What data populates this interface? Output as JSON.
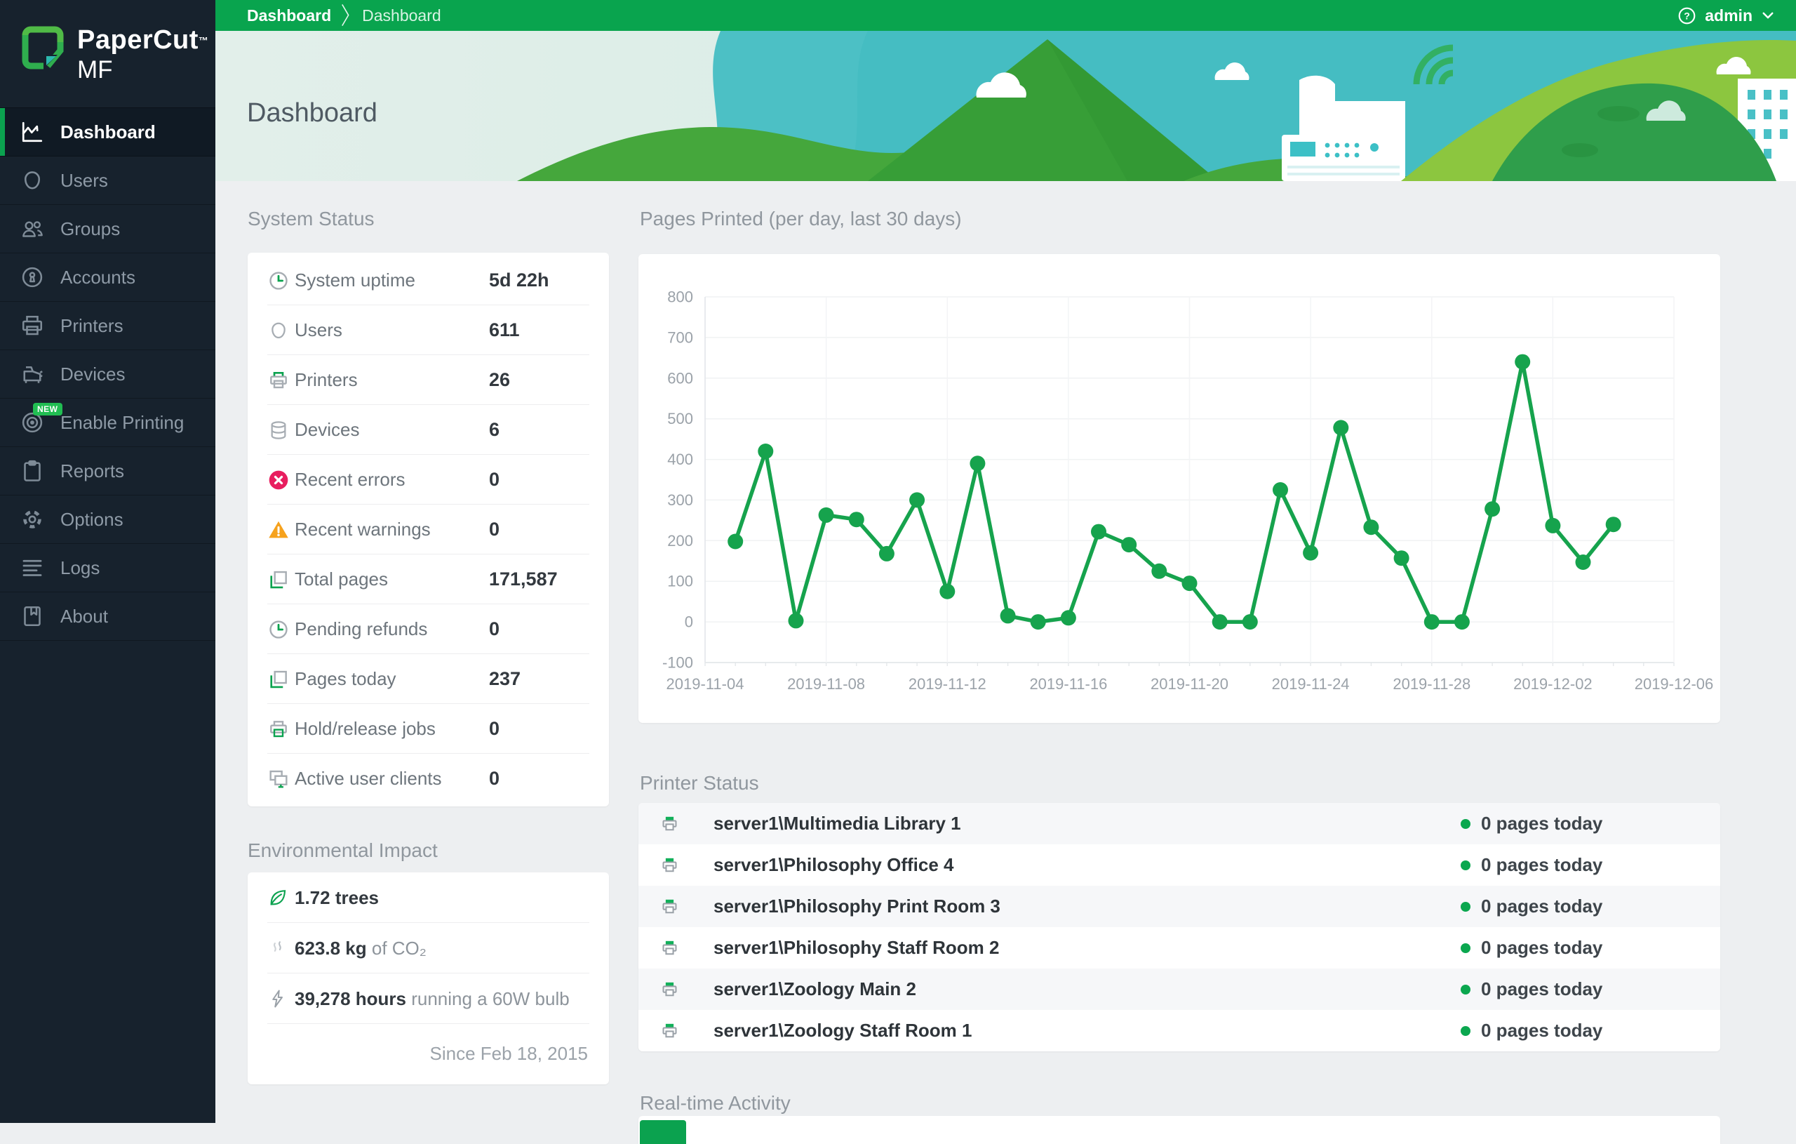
{
  "brand": {
    "name": "PaperCut",
    "tm": "™",
    "product": "MF"
  },
  "topbar": {
    "breadcrumbs": [
      "Dashboard",
      "Dashboard"
    ],
    "user": "admin",
    "accent_color": "#09a44e"
  },
  "header": {
    "title": "Dashboard"
  },
  "sidebar": {
    "items": [
      {
        "label": "Dashboard",
        "icon": "dashboard-icon",
        "active": true
      },
      {
        "label": "Users",
        "icon": "users-icon",
        "active": false
      },
      {
        "label": "Groups",
        "icon": "groups-icon",
        "active": false
      },
      {
        "label": "Accounts",
        "icon": "accounts-icon",
        "active": false
      },
      {
        "label": "Printers",
        "icon": "printers-icon",
        "active": false
      },
      {
        "label": "Devices",
        "icon": "devices-icon",
        "active": false
      },
      {
        "label": "Enable Printing",
        "icon": "enable-printing-target-icon",
        "active": false,
        "badge": "NEW"
      },
      {
        "label": "Reports",
        "icon": "reports-icon",
        "active": false
      },
      {
        "label": "Options",
        "icon": "options-gear-icon",
        "active": false
      },
      {
        "label": "Logs",
        "icon": "logs-icon",
        "active": false
      },
      {
        "label": "About",
        "icon": "about-icon",
        "active": false
      }
    ]
  },
  "system_status": {
    "title": "System Status",
    "rows": [
      {
        "icon": "uptime-clock-icon",
        "label": "System uptime",
        "value": "5d 22h"
      },
      {
        "icon": "user-face-icon",
        "label": "Users",
        "value": "611"
      },
      {
        "icon": "printer-green-icon",
        "label": "Printers",
        "value": "26"
      },
      {
        "icon": "devices-stack-icon",
        "label": "Devices",
        "value": "6"
      },
      {
        "icon": "error-circle-icon",
        "label": "Recent errors",
        "value": "0"
      },
      {
        "icon": "warning-triangle-icon",
        "label": "Recent warnings",
        "value": "0"
      },
      {
        "icon": "pages-icon",
        "label": "Total pages",
        "value": "171,587"
      },
      {
        "icon": "pending-clock-icon",
        "label": "Pending refunds",
        "value": "0"
      },
      {
        "icon": "pages-icon",
        "label": "Pages today",
        "value": "237"
      },
      {
        "icon": "hold-release-printer-icon",
        "label": "Hold/release jobs",
        "value": "0"
      },
      {
        "icon": "active-clients-icon",
        "label": "Active user clients",
        "value": "0"
      }
    ]
  },
  "environmental_impact": {
    "title": "Environmental Impact",
    "rows": [
      {
        "icon": "leaf-icon",
        "bold": "1.72 trees",
        "rest": ""
      },
      {
        "icon": "co2-smoke-icon",
        "bold": "623.8 kg",
        "rest": " of CO₂"
      },
      {
        "icon": "bolt-icon",
        "bold": "39,278 hours",
        "rest": " running a 60W bulb"
      }
    ],
    "since": "Since Feb 18, 2015"
  },
  "printer_status": {
    "title": "Printer Status",
    "status_dot_color": "#0ba74f",
    "rows": [
      {
        "name": "server1\\Multimedia Library 1",
        "status": "0 pages today"
      },
      {
        "name": "server1\\Philosophy Office 4",
        "status": "0 pages today"
      },
      {
        "name": "server1\\Philosophy Print Room 3",
        "status": "0 pages today"
      },
      {
        "name": "server1\\Philosophy Staff Room 2",
        "status": "0 pages today"
      },
      {
        "name": "server1\\Zoology Main 2",
        "status": "0 pages today"
      },
      {
        "name": "server1\\Zoology Staff Room 1",
        "status": "0 pages today"
      }
    ]
  },
  "realtime": {
    "title": "Real-time Activity"
  },
  "chart_data": {
    "type": "line",
    "title": "Pages Printed (per day, last 30 days)",
    "x": [
      "2019-11-05",
      "2019-11-06",
      "2019-11-07",
      "2019-11-08",
      "2019-11-09",
      "2019-11-10",
      "2019-11-11",
      "2019-11-12",
      "2019-11-13",
      "2019-11-14",
      "2019-11-15",
      "2019-11-16",
      "2019-11-17",
      "2019-11-18",
      "2019-11-19",
      "2019-11-20",
      "2019-11-21",
      "2019-11-22",
      "2019-11-23",
      "2019-11-24",
      "2019-11-25",
      "2019-11-26",
      "2019-11-27",
      "2019-11-28",
      "2019-11-29",
      "2019-11-30",
      "2019-12-01",
      "2019-12-02",
      "2019-12-03",
      "2019-12-04"
    ],
    "values": [
      198,
      420,
      3,
      263,
      252,
      168,
      300,
      75,
      390,
      15,
      0,
      10,
      222,
      190,
      125,
      95,
      0,
      0,
      325,
      170,
      478,
      233,
      157,
      0,
      0,
      278,
      640,
      237,
      147,
      240
    ],
    "xlabel": "",
    "ylabel": "",
    "ylim": [
      -100,
      800
    ],
    "ytick_step": 100,
    "xtick_labels": [
      "2019-11-04",
      "2019-11-08",
      "2019-11-12",
      "2019-11-16",
      "2019-11-20",
      "2019-11-24",
      "2019-11-28",
      "2019-12-02",
      "2019-12-06"
    ],
    "axis_start": "2019-11-04",
    "axis_end": "2019-12-06",
    "line_color": "#16a34d",
    "grid": true,
    "legend": null
  }
}
